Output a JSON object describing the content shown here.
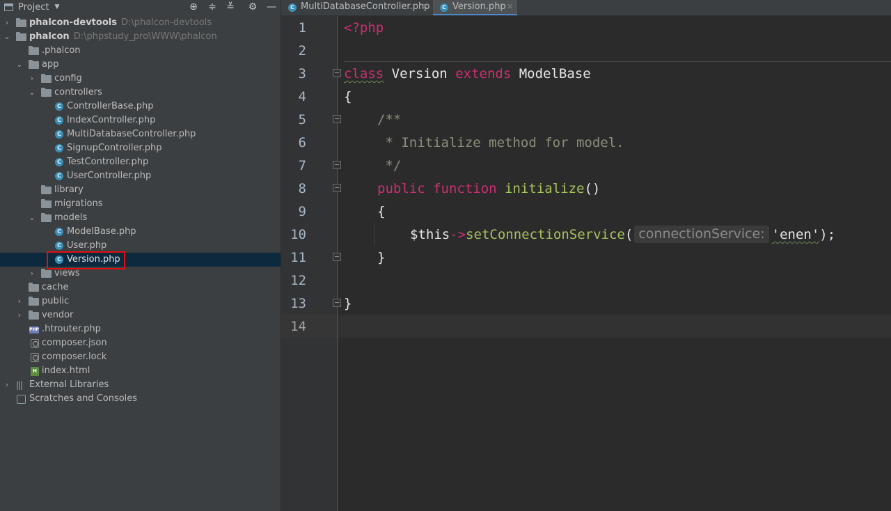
{
  "panel": {
    "title": "Project",
    "tools": [
      "locate-icon",
      "expand-all-icon",
      "collapse-all-icon",
      "gear-icon",
      "minimize-icon"
    ]
  },
  "tree": [
    {
      "label": "phalcon-devtools",
      "path": "D:\\phalcon-devtools",
      "kind": "project"
    },
    {
      "label": "phalcon",
      "path": "D:\\phpstudy_pro\\WWW\\phalcon",
      "kind": "project"
    },
    {
      "label": ".phalcon",
      "kind": "folder"
    },
    {
      "label": "app",
      "kind": "folder"
    },
    {
      "label": "config",
      "kind": "folder"
    },
    {
      "label": "controllers",
      "kind": "folder"
    },
    {
      "label": "ControllerBase.php",
      "kind": "class"
    },
    {
      "label": "IndexController.php",
      "kind": "class"
    },
    {
      "label": "MultiDatabaseController.php",
      "kind": "class"
    },
    {
      "label": "SignupController.php",
      "kind": "class"
    },
    {
      "label": "TestController.php",
      "kind": "class"
    },
    {
      "label": "UserController.php",
      "kind": "class"
    },
    {
      "label": "library",
      "kind": "folder"
    },
    {
      "label": "migrations",
      "kind": "folder"
    },
    {
      "label": "models",
      "kind": "folder"
    },
    {
      "label": "ModelBase.php",
      "kind": "class"
    },
    {
      "label": "User.php",
      "kind": "class"
    },
    {
      "label": "Version.php",
      "kind": "class"
    },
    {
      "label": "views",
      "kind": "folder"
    },
    {
      "label": "cache",
      "kind": "folder"
    },
    {
      "label": "public",
      "kind": "folder"
    },
    {
      "label": "vendor",
      "kind": "folder"
    },
    {
      "label": ".htrouter.php",
      "kind": "php"
    },
    {
      "label": "composer.json",
      "kind": "json"
    },
    {
      "label": "composer.lock",
      "kind": "json"
    },
    {
      "label": "index.html",
      "kind": "html"
    },
    {
      "label": "External Libraries",
      "kind": "library"
    },
    {
      "label": "Scratches and Consoles",
      "kind": "scratch"
    }
  ],
  "tabs": [
    {
      "label": "MultiDatabaseController.php",
      "active": false
    },
    {
      "label": "Version.php",
      "active": true
    }
  ],
  "editor": {
    "line_numbers": [
      "1",
      "2",
      "3",
      "4",
      "5",
      "6",
      "7",
      "8",
      "9",
      "10",
      "11",
      "12",
      "13",
      "14"
    ],
    "code": {
      "l1_tag": "<?php",
      "l3_class": "class",
      "l3_name": "Version",
      "l3_extends": "extends",
      "l3_parent": "ModelBase",
      "l4_brace": "{",
      "l5_comment": "/**",
      "l6_comment": " * Initialize method for model.",
      "l7_comment": " */",
      "l8_public": "public",
      "l8_function": "function",
      "l8_name": "initialize",
      "l8_parens": "()",
      "l9_brace": "{",
      "l10_this": "$this",
      "l10_arrow": "->",
      "l10_method": "setConnectionService",
      "l10_open": "(",
      "l10_hint": "connectionService:",
      "l10_string": "'enen'",
      "l10_close": ");",
      "l11_brace": "}",
      "l13_brace": "}"
    },
    "colors": {
      "keyword": "#cc2e70",
      "function": "#a5c25c",
      "comment": "#8c8c7a",
      "background": "#2b2b2b"
    }
  }
}
